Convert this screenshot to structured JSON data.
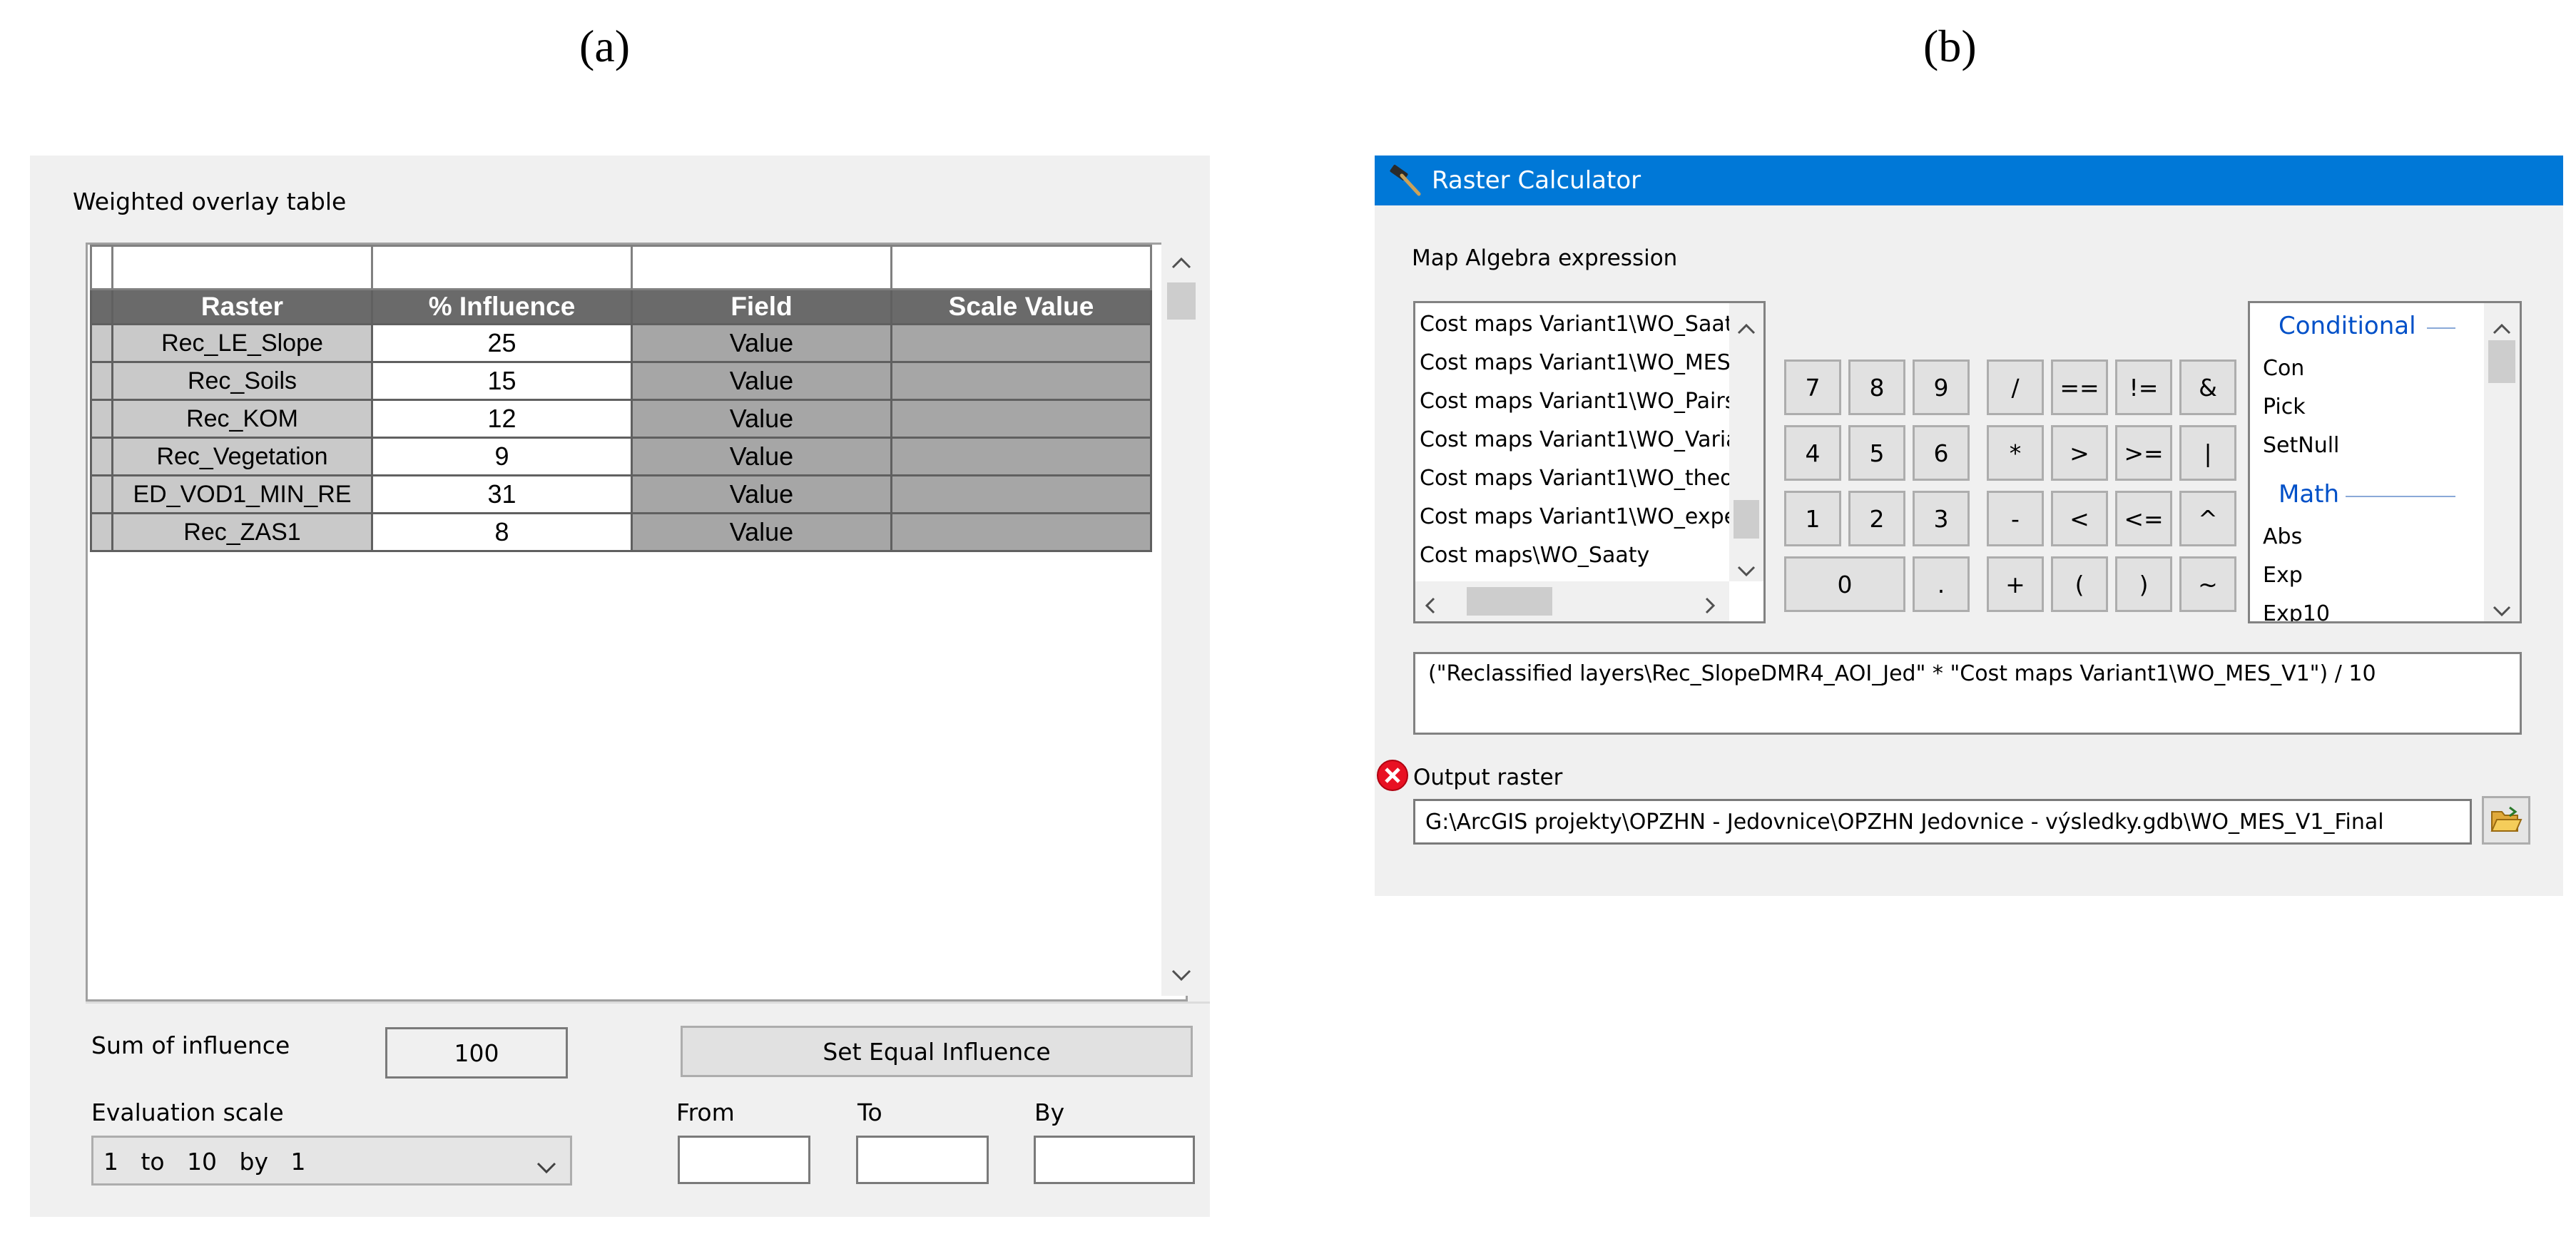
{
  "figure_labels": {
    "a": "(a)",
    "b": "(b)"
  },
  "weighted_overlay": {
    "section_label": "Weighted overlay table",
    "columns": [
      "Raster",
      "% Influence",
      "Field",
      "Scale Value"
    ],
    "rows": [
      {
        "raster": "Rec_LE_Slope",
        "influence": "25",
        "field": "Value",
        "scale": ""
      },
      {
        "raster": "Rec_Soils",
        "influence": "15",
        "field": "Value",
        "scale": ""
      },
      {
        "raster": "Rec_KOM",
        "influence": "12",
        "field": "Value",
        "scale": ""
      },
      {
        "raster": "Rec_Vegetation",
        "influence": "9",
        "field": "Value",
        "scale": ""
      },
      {
        "raster": "ED_VOD1_MIN_RE",
        "influence": "31",
        "field": "Value",
        "scale": ""
      },
      {
        "raster": "Rec_ZAS1",
        "influence": "8",
        "field": "Value",
        "scale": ""
      }
    ],
    "sum_label": "Sum of influence",
    "sum_value": "100",
    "set_equal_button": "Set Equal Influence",
    "eval_scale_label": "Evaluation scale",
    "eval_scale_value": "1   to   10   by   1",
    "from_label": "From",
    "to_label": "To",
    "by_label": "By"
  },
  "raster_calculator": {
    "title": "Raster Calculator",
    "expr_label": "Map Algebra expression",
    "layers": [
      "Cost maps Variant1\\WO_Saat",
      "Cost maps Variant1\\WO_MES_",
      "Cost maps Variant1\\WO_Pairs",
      "Cost maps Variant1\\WO_Varia",
      "Cost maps Variant1\\WO_theo",
      "Cost maps Variant1\\WO_expe",
      "Cost maps\\WO_Saaty"
    ],
    "buttons_row1": [
      "7",
      "8",
      "9",
      "/",
      "==",
      "!=",
      "&"
    ],
    "buttons_row2": [
      "4",
      "5",
      "6",
      "*",
      ">",
      ">=",
      "|"
    ],
    "buttons_row3": [
      "1",
      "2",
      "3",
      "-",
      "<",
      "<=",
      "^"
    ],
    "buttons_row4": [
      "0",
      ".",
      "+",
      "(",
      ")",
      "~"
    ],
    "conditional_header": "Conditional",
    "conditional_items": [
      "Con",
      "Pick",
      "SetNull"
    ],
    "math_header": "Math",
    "math_items": [
      "Abs",
      "Exp",
      "Exp10"
    ],
    "expression": "(\"Reclassified layers\\Rec_SlopeDMR4_AOI_Jed\" * \"Cost maps Variant1\\WO_MES_V1\") / 10",
    "output_label": "Output raster",
    "output_path": "G:\\ArcGIS projekty\\OPZHN - Jedovnice\\OPZHN Jedovnice - výsledky.gdb\\WO_MES_V1_Final"
  },
  "colors": {
    "panel_bg": "#f0f0f0",
    "title_bar": "#0078d7",
    "header_gray": "#6a6a6a",
    "function_blue": "#0050c8",
    "error_red": "#e81123"
  },
  "icons": [
    "hammer-icon",
    "error-icon",
    "folder-open-icon",
    "chevron-up-icon",
    "chevron-down-icon",
    "chevron-left-icon",
    "chevron-right-icon"
  ]
}
